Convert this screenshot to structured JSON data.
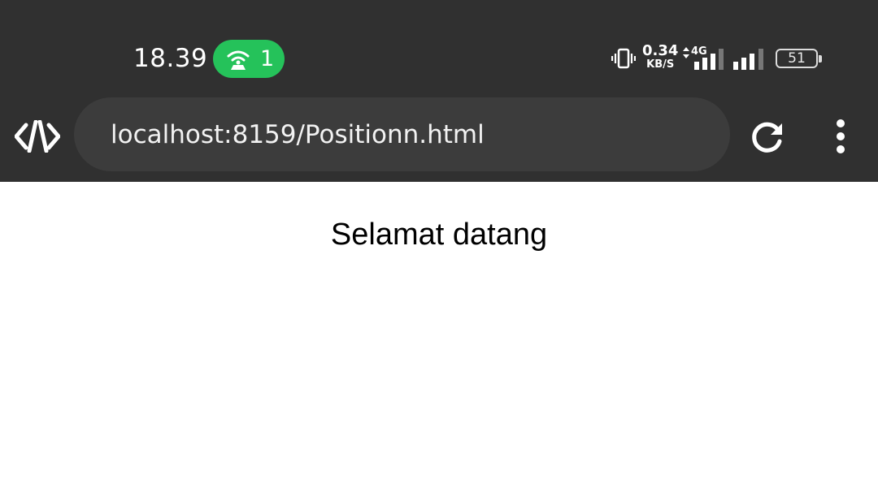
{
  "status_bar": {
    "time": "18.39",
    "hotspot_count": "1",
    "net_speed_value": "0.34",
    "net_speed_unit": "KB/S",
    "network_type": "4G",
    "battery_level": "51",
    "hotspot_color": "#25c25a"
  },
  "browser": {
    "url": "localhost:8159/Positionn.html",
    "logo_icon": "code-brackets-icon",
    "reload_icon": "reload-icon",
    "menu_icon": "more-vertical-icon"
  },
  "page": {
    "heading": "Selamat datang"
  }
}
